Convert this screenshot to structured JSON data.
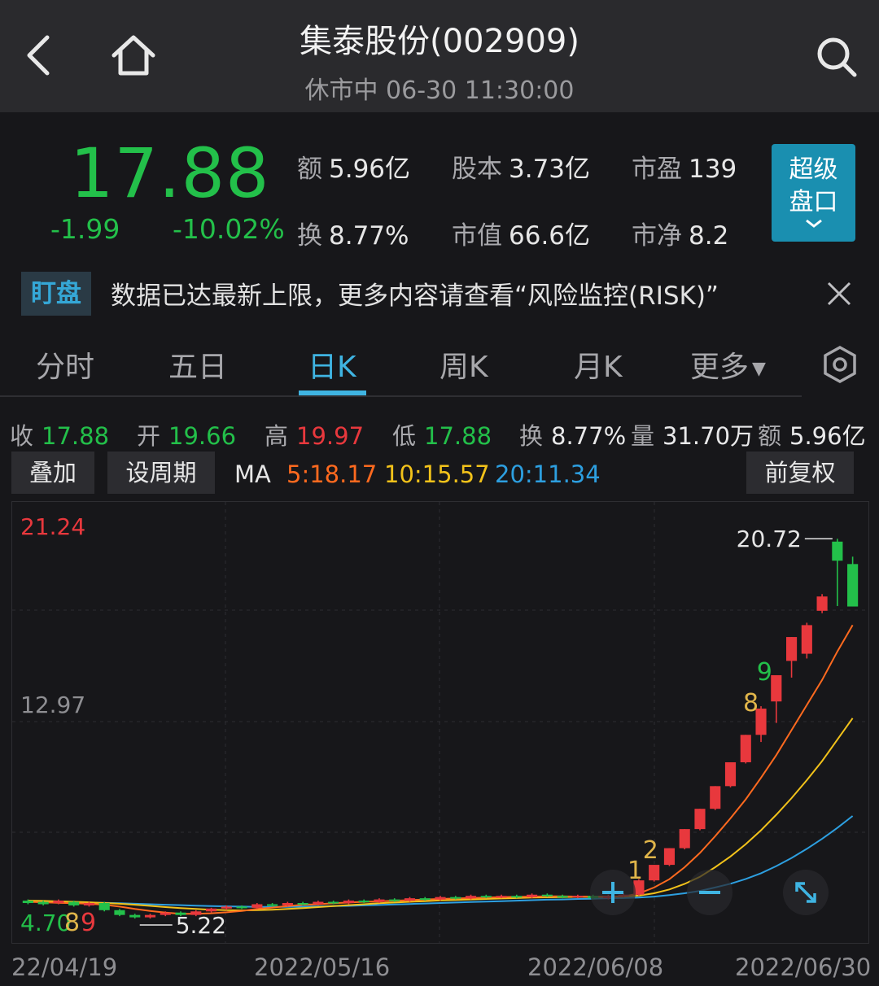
{
  "header": {
    "title": "集泰股份(002909)",
    "status": "休市中 06-30 11:30:00"
  },
  "quote": {
    "price": "17.88",
    "change": "-1.99",
    "change_pct": "-10.02%",
    "stats": [
      {
        "label": "额",
        "value": "5.96亿"
      },
      {
        "label": "股本",
        "value": "3.73亿"
      },
      {
        "label": "市盈",
        "value": "139"
      },
      {
        "label": "换",
        "value": "8.77%"
      },
      {
        "label": "市值",
        "value": "66.6亿"
      },
      {
        "label": "市净",
        "value": "8.2"
      }
    ],
    "super_button": {
      "line1": "超级",
      "line2": "盘口",
      "chevron": "chevron-down-icon"
    }
  },
  "notice": {
    "tag": "盯盘",
    "text": "数据已达最新上限，更多内容请查看“风险监控(RISK)”"
  },
  "tabs": [
    "分时",
    "五日",
    "日K",
    "周K",
    "月K",
    "更多"
  ],
  "active_tab": "日K",
  "day_quote": [
    {
      "label": "收",
      "value": "17.88",
      "color": "#23c04a"
    },
    {
      "label": "开",
      "value": "19.66",
      "color": "#23c04a"
    },
    {
      "label": "高",
      "value": "19.97",
      "color": "#e8383d"
    },
    {
      "label": "低",
      "value": "17.88",
      "color": "#23c04a"
    },
    {
      "label": "换",
      "value": "8.77%",
      "color": "#e6e6e6"
    },
    {
      "label": "量",
      "value": "31.70万",
      "color": "#e6e6e6"
    },
    {
      "label": "额",
      "value": "5.96亿",
      "color": "#e6e6e6"
    }
  ],
  "toolbar": {
    "overlay": "叠加",
    "period": "设周期",
    "ma_label": "MA",
    "ma5": "5:18.17",
    "ma10": "10:15.57",
    "ma20": "20:11.34",
    "adjust": "前复权"
  },
  "colors": {
    "up": "#e8383d",
    "down": "#23c04a",
    "ma5": "#ff6a1f",
    "ma10": "#f2c21a",
    "ma20": "#2d9fe0",
    "accent": "#3fb4e2"
  },
  "chart_data": {
    "type": "candlestick",
    "y_axis_labels": [
      "21.24",
      "12.97",
      "4.70"
    ],
    "x_axis_labels": [
      "22/04/19",
      "2022/05/16",
      "2022/06/08",
      "2022/06/30"
    ],
    "high_marker": "20.72",
    "low_marker": "5.22",
    "td_counts_bottom": [
      "8",
      "9"
    ],
    "td_counts": [
      "1",
      "2",
      "8",
      "9"
    ],
    "candles": [
      {
        "o": 5.55,
        "c": 5.45,
        "h": 5.6,
        "l": 5.4
      },
      {
        "o": 5.5,
        "c": 5.4,
        "h": 5.55,
        "l": 5.35
      },
      {
        "o": 5.45,
        "c": 5.55,
        "h": 5.6,
        "l": 5.4
      },
      {
        "o": 5.5,
        "c": 5.35,
        "h": 5.55,
        "l": 5.3
      },
      {
        "o": 5.35,
        "c": 5.45,
        "h": 5.5,
        "l": 5.3
      },
      {
        "o": 5.45,
        "c": 5.15,
        "h": 5.5,
        "l": 5.1
      },
      {
        "o": 5.15,
        "c": 4.95,
        "h": 5.2,
        "l": 4.9
      },
      {
        "o": 4.95,
        "c": 4.85,
        "h": 5.0,
        "l": 4.8
      },
      {
        "o": 4.85,
        "c": 4.95,
        "h": 5.0,
        "l": 4.8
      },
      {
        "o": 4.95,
        "c": 5.05,
        "h": 5.1,
        "l": 4.9
      },
      {
        "o": 5.05,
        "c": 4.95,
        "h": 5.1,
        "l": 4.9
      },
      {
        "o": 4.95,
        "c": 5.1,
        "h": 5.15,
        "l": 4.9
      },
      {
        "o": 5.1,
        "c": 5.22,
        "h": 5.25,
        "l": 5.05
      },
      {
        "o": 5.22,
        "c": 5.3,
        "h": 5.35,
        "l": 5.15
      },
      {
        "o": 5.3,
        "c": 5.25,
        "h": 5.35,
        "l": 5.2
      },
      {
        "o": 5.25,
        "c": 5.4,
        "h": 5.45,
        "l": 5.2
      },
      {
        "o": 5.4,
        "c": 5.35,
        "h": 5.45,
        "l": 5.3
      },
      {
        "o": 5.35,
        "c": 5.45,
        "h": 5.5,
        "l": 5.3
      },
      {
        "o": 5.45,
        "c": 5.4,
        "h": 5.5,
        "l": 5.35
      },
      {
        "o": 5.4,
        "c": 5.5,
        "h": 5.55,
        "l": 5.35
      },
      {
        "o": 5.5,
        "c": 5.45,
        "h": 5.55,
        "l": 5.4
      },
      {
        "o": 5.45,
        "c": 5.55,
        "h": 5.6,
        "l": 5.4
      },
      {
        "o": 5.55,
        "c": 5.5,
        "h": 5.6,
        "l": 5.45
      },
      {
        "o": 5.5,
        "c": 5.6,
        "h": 5.65,
        "l": 5.45
      },
      {
        "o": 5.6,
        "c": 5.55,
        "h": 5.65,
        "l": 5.5
      },
      {
        "o": 5.55,
        "c": 5.65,
        "h": 5.7,
        "l": 5.5
      },
      {
        "o": 5.65,
        "c": 5.6,
        "h": 5.7,
        "l": 5.55
      },
      {
        "o": 5.6,
        "c": 5.7,
        "h": 5.75,
        "l": 5.55
      },
      {
        "o": 5.7,
        "c": 5.65,
        "h": 5.75,
        "l": 5.6
      },
      {
        "o": 5.65,
        "c": 5.75,
        "h": 5.8,
        "l": 5.6
      },
      {
        "o": 5.75,
        "c": 5.7,
        "h": 5.8,
        "l": 5.65
      },
      {
        "o": 5.7,
        "c": 5.75,
        "h": 5.8,
        "l": 5.65
      },
      {
        "o": 5.75,
        "c": 5.7,
        "h": 5.8,
        "l": 5.65
      },
      {
        "o": 5.7,
        "c": 5.8,
        "h": 5.85,
        "l": 5.65
      },
      {
        "o": 5.8,
        "c": 5.75,
        "h": 5.85,
        "l": 5.7
      },
      {
        "o": 5.75,
        "c": 5.7,
        "h": 5.8,
        "l": 5.65
      },
      {
        "o": 5.7,
        "c": 5.75,
        "h": 5.8,
        "l": 5.65
      },
      {
        "o": 5.75,
        "c": 5.65,
        "h": 5.8,
        "l": 5.6
      },
      {
        "o": 5.65,
        "c": 5.75,
        "h": 5.8,
        "l": 5.6
      },
      {
        "o": 5.75,
        "c": 5.8,
        "h": 5.85,
        "l": 5.7
      },
      {
        "o": 5.8,
        "c": 6.4,
        "h": 6.45,
        "l": 5.75
      },
      {
        "o": 6.4,
        "c": 7.05,
        "h": 7.05,
        "l": 6.35
      },
      {
        "o": 7.05,
        "c": 7.75,
        "h": 7.75,
        "l": 7.0
      },
      {
        "o": 7.75,
        "c": 8.55,
        "h": 8.55,
        "l": 7.7
      },
      {
        "o": 8.55,
        "c": 9.4,
        "h": 9.4,
        "l": 8.5
      },
      {
        "o": 9.4,
        "c": 10.35,
        "h": 10.35,
        "l": 9.35
      },
      {
        "o": 10.35,
        "c": 11.35,
        "h": 11.35,
        "l": 10.3
      },
      {
        "o": 11.35,
        "c": 12.5,
        "h": 12.5,
        "l": 11.3
      },
      {
        "o": 12.5,
        "c": 13.6,
        "h": 13.7,
        "l": 12.2
      },
      {
        "o": 13.9,
        "c": 15.0,
        "h": 15.0,
        "l": 13.0
      },
      {
        "o": 15.6,
        "c": 16.6,
        "h": 16.6,
        "l": 14.9
      },
      {
        "o": 15.9,
        "c": 17.1,
        "h": 17.2,
        "l": 15.7
      },
      {
        "o": 17.7,
        "c": 18.3,
        "h": 18.4,
        "l": 17.6
      },
      {
        "o": 20.6,
        "c": 19.8,
        "h": 20.72,
        "l": 17.9
      },
      {
        "o": 19.66,
        "c": 17.88,
        "h": 19.97,
        "l": 17.88
      }
    ],
    "ma5": [
      5.5,
      5.48,
      5.46,
      5.44,
      5.42,
      5.38,
      5.3,
      5.2,
      5.12,
      5.05,
      5.0,
      5.0,
      5.02,
      5.06,
      5.12,
      5.2,
      5.26,
      5.32,
      5.38,
      5.4,
      5.44,
      5.47,
      5.5,
      5.52,
      5.55,
      5.57,
      5.6,
      5.62,
      5.64,
      5.66,
      5.68,
      5.7,
      5.71,
      5.72,
      5.73,
      5.73,
      5.72,
      5.72,
      5.72,
      5.73,
      5.85,
      6.1,
      6.45,
      6.95,
      7.55,
      8.25,
      9.0,
      9.8,
      10.7,
      11.65,
      12.7,
      13.75,
      14.8,
      16.0,
      17.1
    ],
    "ma10": [
      5.55,
      5.54,
      5.52,
      5.5,
      5.48,
      5.45,
      5.42,
      5.38,
      5.33,
      5.28,
      5.24,
      5.2,
      5.17,
      5.15,
      5.14,
      5.15,
      5.17,
      5.2,
      5.24,
      5.28,
      5.32,
      5.36,
      5.4,
      5.44,
      5.47,
      5.5,
      5.53,
      5.56,
      5.58,
      5.6,
      5.62,
      5.64,
      5.66,
      5.68,
      5.69,
      5.7,
      5.71,
      5.71,
      5.71,
      5.72,
      5.76,
      5.86,
      6.02,
      6.25,
      6.55,
      6.95,
      7.4,
      7.92,
      8.5,
      9.15,
      9.85,
      10.6,
      11.4,
      12.3,
      13.2
    ],
    "ma20": [
      5.5,
      5.5,
      5.49,
      5.48,
      5.47,
      5.46,
      5.44,
      5.42,
      5.4,
      5.38,
      5.36,
      5.34,
      5.32,
      5.31,
      5.3,
      5.29,
      5.29,
      5.29,
      5.3,
      5.31,
      5.32,
      5.33,
      5.35,
      5.37,
      5.39,
      5.41,
      5.43,
      5.45,
      5.47,
      5.49,
      5.51,
      5.53,
      5.55,
      5.57,
      5.59,
      5.6,
      5.62,
      5.63,
      5.65,
      5.66,
      5.68,
      5.72,
      5.78,
      5.86,
      5.96,
      6.1,
      6.26,
      6.46,
      6.7,
      7.0,
      7.34,
      7.72,
      8.14,
      8.6,
      9.1
    ],
    "ylim": [
      4.7,
      21.24
    ]
  }
}
